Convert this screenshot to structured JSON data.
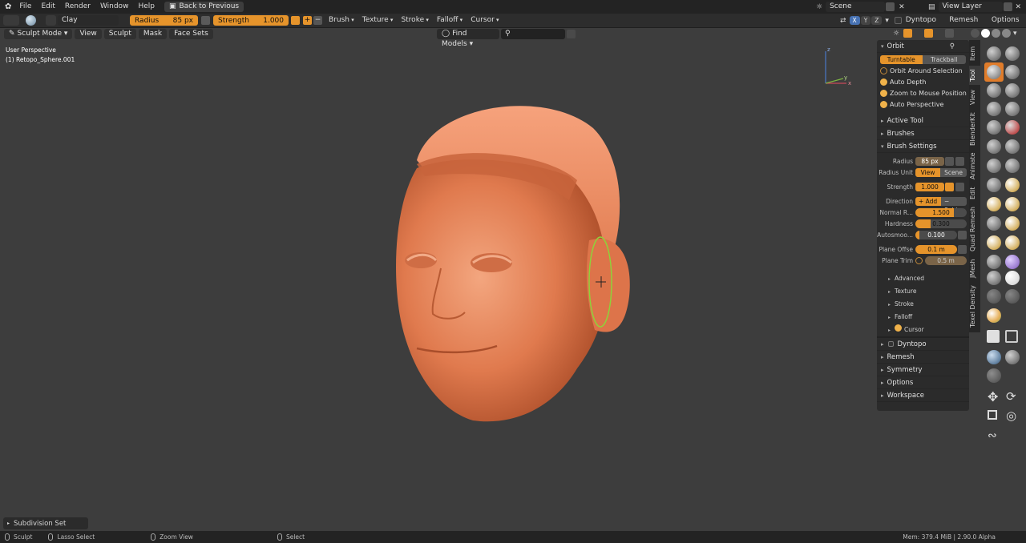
{
  "menu": {
    "items": [
      "File",
      "Edit",
      "Render",
      "Window",
      "Help"
    ],
    "back_button": "Back to Previous",
    "scene": "Scene",
    "view_layer": "View Layer"
  },
  "tool_header": {
    "brush_name": "Clay",
    "radius_label": "Radius",
    "radius_value": "85 px",
    "strength_label": "Strength",
    "strength_value": "1.000",
    "dropdowns": [
      "Brush",
      "Texture",
      "Stroke",
      "Falloff",
      "Cursor"
    ],
    "axes": [
      "X",
      "Y",
      "Z"
    ],
    "dyntopo": "Dyntopo",
    "remesh": "Remesh",
    "options": "Options"
  },
  "viewport_header": {
    "mode": "Sculpt Mode",
    "menus": [
      "View",
      "Sculpt",
      "Mask",
      "Face Sets"
    ],
    "find_models": "Find Models"
  },
  "viewport": {
    "perspective": "User Perspective",
    "object": "(1) Retopo_Sphere.001",
    "last_op": "Subdivision Set",
    "gizmo": {
      "x": "x",
      "y": "y",
      "z": "z"
    }
  },
  "npanel": {
    "orbit_title": "Orbit",
    "turntable": "Turntable",
    "trackball": "Trackball",
    "checks": [
      {
        "label": "Orbit Around Selection",
        "on": false
      },
      {
        "label": "Auto Depth",
        "on": true
      },
      {
        "label": "Zoom to Mouse Position",
        "on": true
      },
      {
        "label": "Auto Perspective",
        "on": true
      }
    ],
    "sections_top": [
      "Active Tool",
      "Brushes"
    ],
    "brush_settings": "Brush Settings",
    "radius_label": "Radius",
    "radius_value": "85 px",
    "radius_unit_label": "Radius Unit",
    "unit_view": "View",
    "unit_scene": "Scene",
    "strength_label": "Strength",
    "strength_value": "1.000",
    "direction_label": "Direction",
    "dir_add": "Add",
    "dir_subtract": "Subt",
    "normal_label": "Normal R...",
    "normal_value": "1.500",
    "normal_fill": 0.75,
    "hardness_label": "Hardness",
    "hardness_value": "0.300",
    "hardness_fill": 0.3,
    "autosmooth_label": "Autosmoo...",
    "autosmooth_value": "0.100",
    "autosmooth_fill": 0.1,
    "plane_offset_label": "Plane Offse",
    "plane_offset_value": "0.1 m",
    "plane_trim_label": "Plane Trim",
    "plane_trim_value": "0.5 m",
    "subsections": [
      "Advanced",
      "Texture",
      "Stroke",
      "Falloff",
      "Cursor"
    ],
    "sections_bottom": [
      "Dyntopo",
      "Remesh",
      "Symmetry",
      "Options",
      "Workspace"
    ]
  },
  "vtabs": [
    "Item",
    "Tool",
    "View",
    "BlenderKit",
    "Animate",
    "Edit",
    "Quad Remesh",
    "JMesh",
    "Texel Density"
  ],
  "status": {
    "sculpt": "Sculpt",
    "lasso": "Lasso Select",
    "zoom": "Zoom View",
    "select": "Select",
    "mem": "Mem: 379.4 MiB | 2.90.0 Alpha"
  },
  "colors": {
    "accent": "#e6942b",
    "viewport": "#3d3d3d",
    "panel": "#2b2b2b",
    "skin": "#e07a4e"
  }
}
